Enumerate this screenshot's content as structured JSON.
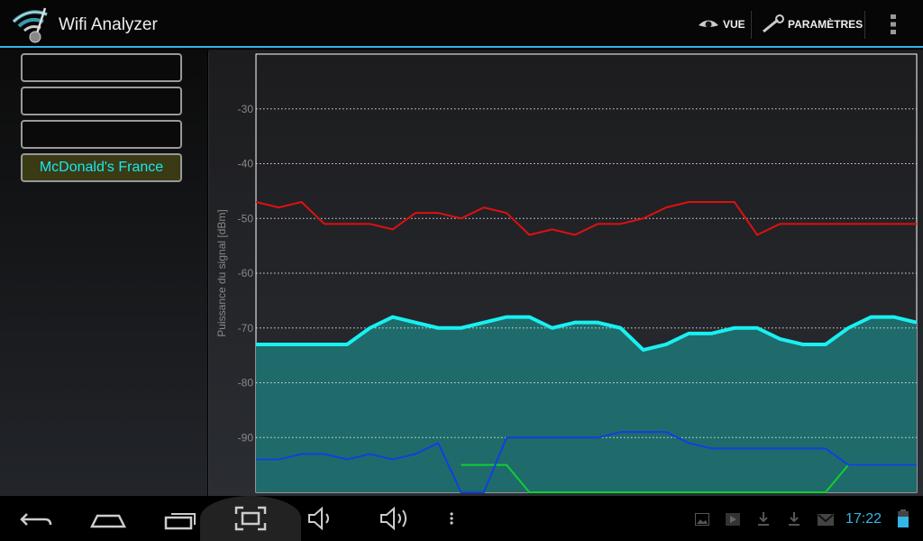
{
  "app": {
    "title": "Wifi Analyzer",
    "icon": "wifi-antenna-icon"
  },
  "actions": [
    {
      "label": "VUE",
      "icon": "eye-icon"
    },
    {
      "label": "PARAMÈTRES",
      "icon": "wrench-icon"
    },
    {
      "label": "",
      "icon": "overflow-menu-icon"
    }
  ],
  "networks": [
    {
      "label": ""
    },
    {
      "label": ""
    },
    {
      "label": ""
    },
    {
      "label": "McDonald's France",
      "selected": true
    }
  ],
  "colors": {
    "accent": "#33b5e5",
    "selected_ssid": "#19e8f0",
    "selected_bg": "#3a3a14"
  },
  "chart_data": {
    "type": "line",
    "ylabel": "Puissance du signal [dBm]",
    "xlabel": "",
    "ylim": [
      -100,
      -20
    ],
    "yticks": [
      -30,
      -40,
      -50,
      -60,
      -70,
      -80,
      -90
    ],
    "grid": "horizontal dotted",
    "series": [
      {
        "color": "#e01010",
        "values": [
          -47,
          -48,
          -47,
          -51,
          -51,
          -51,
          -52,
          -49,
          -49,
          -50,
          -48,
          -49,
          -53,
          -52,
          -53,
          -51,
          -51,
          -50,
          -48,
          -47,
          -47,
          -47,
          -53,
          -51,
          -51,
          -51,
          -51,
          -51,
          -51,
          -51
        ]
      },
      {
        "color": "#19f0f0",
        "highlighted": true,
        "fill": "#1f6b6b",
        "values": [
          -73,
          -73,
          -73,
          -73,
          -73,
          -70,
          -68,
          -69,
          -70,
          -70,
          -69,
          -68,
          -68,
          -70,
          -69,
          -69,
          -70,
          -74,
          -73,
          -71,
          -71,
          -70,
          -70,
          -72,
          -73,
          -73,
          -70,
          -68,
          -68,
          -69
        ]
      },
      {
        "color": "#1040e0",
        "values": [
          -94,
          -94,
          -93,
          -93,
          -94,
          -93,
          -94,
          -93,
          -91,
          -100,
          -100,
          -90,
          -90,
          -90,
          -90,
          -90,
          -89,
          -89,
          -89,
          -91,
          -92,
          -92,
          -92,
          -92,
          -92,
          -92,
          -95,
          -95,
          -95,
          -95
        ]
      },
      {
        "color": "#10d030",
        "values": [
          null,
          null,
          null,
          null,
          null,
          null,
          null,
          null,
          null,
          -95,
          -95,
          -95,
          -100,
          -100,
          -100,
          -100,
          -100,
          -100,
          -100,
          -100,
          -100,
          -100,
          -100,
          -100,
          -100,
          -100,
          -95,
          -95,
          -95,
          -95
        ]
      }
    ]
  },
  "navbar": {
    "buttons": [
      "back-icon",
      "home-icon",
      "recent-apps-icon",
      "screenshot-icon",
      "volume-down-icon",
      "volume-up-icon",
      "menu-icon"
    ]
  },
  "status": {
    "time": "17:22",
    "icons": [
      "gallery-icon",
      "play-store-icon",
      "download-icon",
      "download-icon",
      "gmail-icon",
      "battery-icon"
    ]
  }
}
